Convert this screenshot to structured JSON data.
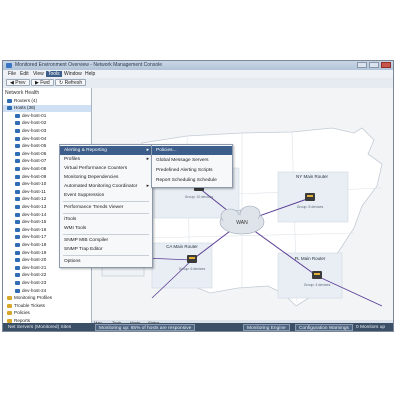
{
  "window": {
    "title": "Monitored Environment Overview - Network Management Console"
  },
  "menubar": {
    "items": [
      "File",
      "Edit",
      "View",
      "Tools",
      "Window",
      "Help"
    ],
    "active_index": 3
  },
  "toolbar": {
    "buttons": [
      "Prev",
      "Fwd",
      "Refresh"
    ]
  },
  "sidebar": {
    "header": "Network Health",
    "items": [
      "Routers (4)",
      "Hosts (36)",
      "dev-host-01",
      "dev-host-02",
      "dev-host-03",
      "dev-host-04",
      "dev-host-05",
      "dev-host-06",
      "dev-host-07",
      "dev-host-08",
      "dev-host-09",
      "dev-host-10",
      "dev-host-11",
      "dev-host-12",
      "dev-host-13",
      "dev-host-14",
      "dev-host-15",
      "dev-host-16",
      "dev-host-17",
      "dev-host-18",
      "dev-host-19",
      "dev-host-20",
      "dev-host-21",
      "dev-host-22",
      "dev-host-23",
      "dev-host-24",
      "Monitoring Profiles",
      "Trouble Tickets",
      "Policies",
      "Reports"
    ],
    "selected_index": 1
  },
  "tools_menu": {
    "items": [
      {
        "label": "Alerting & Reporting",
        "submenu": true
      },
      {
        "label": "Profiles",
        "submenu": true
      },
      {
        "label": "Virtual Performance Counters",
        "submenu": false
      },
      {
        "label": "Monitoring Dependencies",
        "submenu": false
      },
      {
        "label": "Automated Monitoring Coordinator",
        "submenu": true
      },
      {
        "label": "Event Suppression",
        "submenu": false
      },
      {
        "label": "Performance Trends Viewer",
        "submenu": false
      },
      {
        "label": "iTools",
        "submenu": false
      },
      {
        "label": "WMI Tools",
        "submenu": false
      },
      {
        "label": "SNMP MIB Compiler",
        "submenu": false
      },
      {
        "label": "SNMP Trap Editor",
        "submenu": false
      },
      {
        "label": "Options",
        "submenu": false
      }
    ],
    "highlight_index": 0
  },
  "submenu": {
    "items": [
      "Policies...",
      "Global Message Servers",
      "Predefined Alerting Scripts",
      "Report Scheduling Schedule"
    ],
    "highlight_index": 0
  },
  "map": {
    "cloud_label": "WAN",
    "nodes": [
      {
        "id": "ma",
        "label": "MA Hub Router",
        "caption": "Group: 10 devices"
      },
      {
        "id": "ny",
        "label": "NY Main Router",
        "caption": "Group: 8 devices"
      },
      {
        "id": "ca",
        "label": "CA Main Router",
        "caption": "Group: 6 devices"
      },
      {
        "id": "fl",
        "label": "FL Main Router",
        "caption": "Group: 4 devices"
      }
    ],
    "group_box_label": "TX Hosts"
  },
  "bottom_tabs": [
    "Map",
    "Tools",
    "Hosts",
    "Status"
  ],
  "statusbar": {
    "left": "Net Servers (Monitored) Sites",
    "middle": "Monitoring up: 85% of hosts are responsive",
    "right_1": "Monitoring Engine",
    "right_2": "Configuration Warnings",
    "right_3": "0 Monitors up"
  },
  "colors": {
    "link": "#5b3f96",
    "menu_highlight": "#3d5e8a",
    "statusbar": "#3b4f66"
  }
}
